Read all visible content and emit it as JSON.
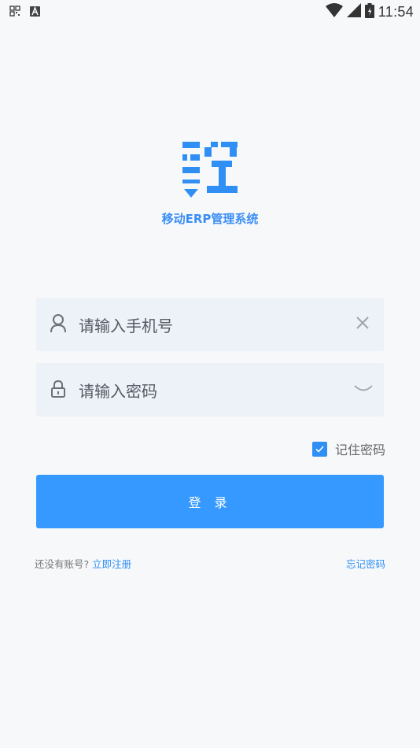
{
  "status_bar": {
    "time": "11:54",
    "icons": [
      "apps-icon",
      "a-icon",
      "wifi-icon",
      "signal-icon",
      "battery-icon"
    ]
  },
  "app": {
    "title": "移动ERP管理系统",
    "logo": "erp-logo",
    "brand_color": "#3699ff"
  },
  "form": {
    "phone_placeholder": "请输入手机号",
    "password_placeholder": "请输入密码",
    "remember_label": "记住密码",
    "remember_checked": true,
    "login_label": "登 录"
  },
  "footer": {
    "no_account": "还没有账号?",
    "register_link": "立即注册",
    "forgot_link": "忘记密码"
  }
}
